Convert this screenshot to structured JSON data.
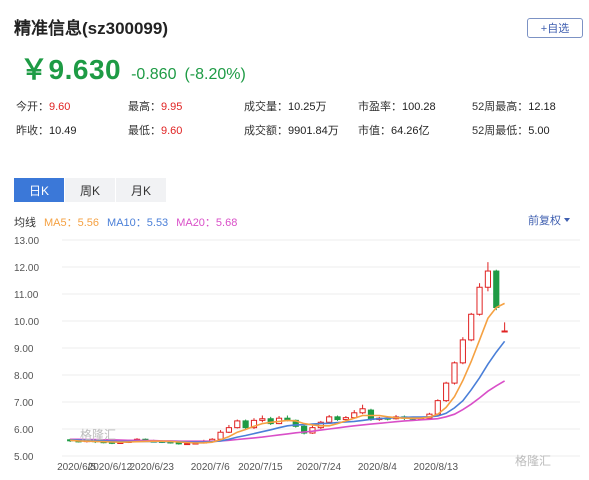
{
  "header": {
    "title": "精准信息(sz300099)",
    "add_watch": "+自选"
  },
  "price": {
    "symbol": "￥",
    "value": "9.630",
    "change": "-0.860",
    "change_pct": "(-8.20%)"
  },
  "quote": {
    "row1": [
      {
        "label": "今开：",
        "value": "9.60",
        "tone": "red"
      },
      {
        "label": "最高：",
        "value": "9.95",
        "tone": "red"
      },
      {
        "label": "成交量：",
        "value": "10.25万",
        "tone": "dark"
      },
      {
        "label": "市盈率：",
        "value": "100.28",
        "tone": "dark"
      },
      {
        "label": "52周最高：",
        "value": "12.18",
        "tone": "dark"
      }
    ],
    "row2": [
      {
        "label": "昨收：",
        "value": "10.49",
        "tone": "dark"
      },
      {
        "label": "最低：",
        "value": "9.60",
        "tone": "red"
      },
      {
        "label": "成交额：",
        "value": "9901.84万",
        "tone": "dark"
      },
      {
        "label": "市值：",
        "value": "64.26亿",
        "tone": "dark"
      },
      {
        "label": "52周最低：",
        "value": "5.00",
        "tone": "dark"
      }
    ]
  },
  "tabs": [
    {
      "label": "日K",
      "active": true
    },
    {
      "label": "周K",
      "active": false
    },
    {
      "label": "月K",
      "active": false
    }
  ],
  "ma_legend": {
    "label": "均线",
    "ma5": "MA5：5.56",
    "ma10": "MA10：5.53",
    "ma20": "MA20：5.68"
  },
  "adjust": "前复权",
  "watermarks": [
    "格隆汇",
    "格隆汇"
  ],
  "colors": {
    "up": "#e02222",
    "down": "#1e9b45",
    "ma5": "#f5a142",
    "ma10": "#4a7fd8",
    "ma20": "#d94fc8",
    "tab_active": "#3b78d8"
  },
  "chart_data": {
    "type": "candlestick",
    "ylim": [
      5.0,
      13.0
    ],
    "yticks": [
      "13.00",
      "12.00",
      "11.00",
      "10.00",
      "9.00",
      "8.00",
      "7.00",
      "6.00",
      "5.00"
    ],
    "xticks": [
      "2020/6/5",
      "2020/6/12",
      "2020/6/23",
      "2020/7/6",
      "2020/7/15",
      "2020/7/24",
      "2020/8/4",
      "2020/8/13"
    ],
    "xtick_index": [
      1,
      5,
      10,
      17,
      23,
      30,
      37,
      44
    ],
    "candles": [
      [
        5.6,
        5.58,
        5.64,
        5.52
      ],
      [
        5.56,
        5.55,
        5.62,
        5.5
      ],
      [
        5.55,
        5.57,
        5.61,
        5.5
      ],
      [
        5.57,
        5.53,
        5.6,
        5.48
      ],
      [
        5.53,
        5.51,
        5.58,
        5.47
      ],
      [
        5.55,
        5.47,
        5.59,
        5.44
      ],
      [
        5.48,
        5.5,
        5.55,
        5.45
      ],
      [
        5.5,
        5.56,
        5.6,
        5.48
      ],
      [
        5.56,
        5.62,
        5.66,
        5.53
      ],
      [
        5.62,
        5.55,
        5.65,
        5.52
      ],
      [
        5.55,
        5.54,
        5.6,
        5.5
      ],
      [
        5.54,
        5.52,
        5.58,
        5.48
      ],
      [
        5.52,
        5.5,
        5.56,
        5.46
      ],
      [
        5.5,
        5.45,
        5.54,
        5.42
      ],
      [
        5.45,
        5.46,
        5.5,
        5.41
      ],
      [
        5.46,
        5.48,
        5.52,
        5.43
      ],
      [
        5.48,
        5.55,
        5.6,
        5.46
      ],
      [
        5.55,
        5.62,
        5.66,
        5.52
      ],
      [
        5.62,
        5.88,
        5.96,
        5.6
      ],
      [
        5.88,
        6.05,
        6.15,
        5.85
      ],
      [
        6.05,
        6.3,
        6.35,
        6.02
      ],
      [
        6.3,
        6.05,
        6.35,
        5.98
      ],
      [
        6.05,
        6.32,
        6.4,
        6.0
      ],
      [
        6.32,
        6.38,
        6.5,
        6.25
      ],
      [
        6.38,
        6.2,
        6.45,
        6.15
      ],
      [
        6.2,
        6.4,
        6.48,
        6.18
      ],
      [
        6.4,
        6.32,
        6.5,
        6.28
      ],
      [
        6.32,
        6.1,
        6.35,
        6.05
      ],
      [
        6.1,
        5.85,
        6.15,
        5.8
      ],
      [
        5.85,
        6.05,
        6.12,
        5.82
      ],
      [
        6.05,
        6.25,
        6.3,
        6.0
      ],
      [
        6.25,
        6.45,
        6.52,
        6.2
      ],
      [
        6.45,
        6.35,
        6.5,
        6.3
      ],
      [
        6.35,
        6.42,
        6.48,
        6.3
      ],
      [
        6.42,
        6.6,
        6.7,
        6.38
      ],
      [
        6.6,
        6.75,
        6.9,
        6.55
      ],
      [
        6.7,
        6.35,
        6.75,
        6.3
      ],
      [
        6.35,
        6.4,
        6.45,
        6.3
      ],
      [
        6.4,
        6.38,
        6.48,
        6.32
      ],
      [
        6.38,
        6.45,
        6.52,
        6.35
      ],
      [
        6.45,
        6.4,
        6.5,
        6.33
      ],
      [
        6.4,
        6.38,
        6.45,
        6.3
      ],
      [
        6.38,
        6.4,
        6.46,
        6.32
      ],
      [
        6.4,
        6.55,
        6.6,
        6.36
      ],
      [
        6.55,
        7.05,
        7.1,
        6.5
      ],
      [
        7.05,
        7.7,
        7.75,
        7.0
      ],
      [
        7.7,
        8.45,
        8.5,
        7.65
      ],
      [
        8.45,
        9.3,
        9.4,
        8.4
      ],
      [
        9.3,
        10.25,
        10.3,
        9.25
      ],
      [
        10.25,
        11.25,
        11.4,
        10.2
      ],
      [
        11.25,
        11.85,
        12.18,
        11.1
      ],
      [
        11.85,
        10.5,
        11.9,
        10.4
      ],
      [
        9.6,
        9.63,
        9.95,
        9.6
      ]
    ],
    "ma5": [
      5.58,
      5.56,
      5.55,
      5.54,
      5.53,
      5.52,
      5.51,
      5.52,
      5.53,
      5.54,
      5.55,
      5.55,
      5.54,
      5.52,
      5.5,
      5.48,
      5.49,
      5.51,
      5.6,
      5.72,
      5.88,
      5.98,
      6.1,
      6.2,
      6.25,
      6.28,
      6.32,
      6.3,
      6.2,
      6.15,
      6.12,
      6.12,
      6.2,
      6.3,
      6.4,
      6.5,
      6.5,
      6.5,
      6.45,
      6.42,
      6.4,
      6.4,
      6.4,
      6.44,
      6.55,
      6.8,
      7.2,
      7.8,
      8.5,
      9.3,
      10.1,
      10.5,
      10.65
    ],
    "ma10": [
      5.6,
      5.59,
      5.58,
      5.57,
      5.56,
      5.55,
      5.54,
      5.54,
      5.54,
      5.54,
      5.54,
      5.54,
      5.53,
      5.53,
      5.52,
      5.52,
      5.52,
      5.53,
      5.56,
      5.62,
      5.7,
      5.76,
      5.83,
      5.9,
      5.97,
      6.05,
      6.12,
      6.15,
      6.16,
      6.18,
      6.2,
      6.21,
      6.24,
      6.26,
      6.28,
      6.32,
      6.36,
      6.38,
      6.4,
      6.42,
      6.43,
      6.44,
      6.44,
      6.45,
      6.48,
      6.58,
      6.78,
      7.05,
      7.45,
      7.9,
      8.4,
      8.85,
      9.25
    ],
    "ma20": [
      5.62,
      5.62,
      5.61,
      5.61,
      5.6,
      5.6,
      5.59,
      5.58,
      5.58,
      5.57,
      5.57,
      5.56,
      5.56,
      5.55,
      5.55,
      5.55,
      5.55,
      5.55,
      5.56,
      5.58,
      5.61,
      5.64,
      5.67,
      5.7,
      5.74,
      5.78,
      5.82,
      5.86,
      5.89,
      5.92,
      5.96,
      6.0,
      6.04,
      6.08,
      6.12,
      6.15,
      6.18,
      6.21,
      6.24,
      6.27,
      6.3,
      6.32,
      6.34,
      6.36,
      6.38,
      6.45,
      6.55,
      6.72,
      6.92,
      7.15,
      7.4,
      7.6,
      7.78
    ]
  }
}
